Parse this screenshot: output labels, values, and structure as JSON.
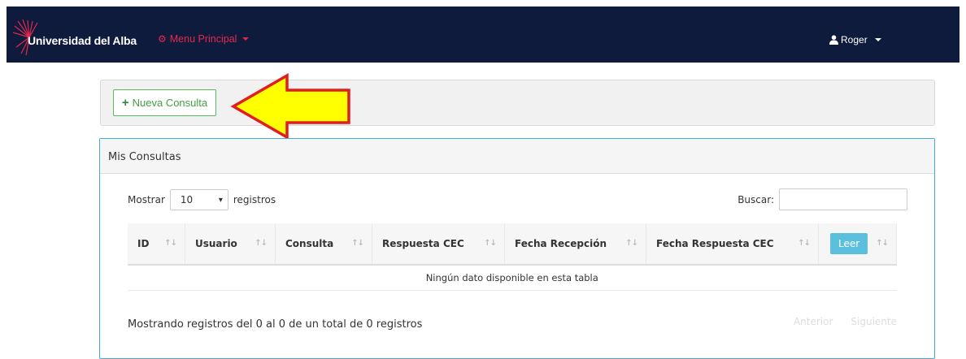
{
  "navbar": {
    "brand": "Universidad del Alba",
    "menu_label": "Menu Principal",
    "user_label": "Roger"
  },
  "toolbar": {
    "new_button_label": "Nueva Consulta"
  },
  "panel": {
    "title": "Mis Consultas",
    "length_prefix": "Mostrar",
    "length_value": "10",
    "length_suffix": "registros",
    "search_label": "Buscar:",
    "columns": [
      "ID",
      "Usuario",
      "Consulta",
      "Respuesta CEC",
      "Fecha Recepción",
      "Fecha Respuesta CEC"
    ],
    "read_button_label": "Leer",
    "empty_message": "Ningún dato disponible en esta tabla",
    "info": "Mostrando registros del 0 al 0 de un total de 0 registros",
    "prev_label": "Anterior",
    "next_label": "Siguiente"
  },
  "colors": {
    "navbar_bg": "#0e1b3d",
    "menu_accent": "#e5284a",
    "success": "#5cb85c",
    "info": "#5bc0de",
    "panel_border": "#48a6d7",
    "annotation_arrow_fill": "#ffff00",
    "annotation_arrow_stroke": "#e11d1d"
  },
  "icons": {
    "menu": "cogs-icon",
    "user": "user-icon",
    "new": "plus-icon",
    "annotation": "left-arrow-icon"
  }
}
